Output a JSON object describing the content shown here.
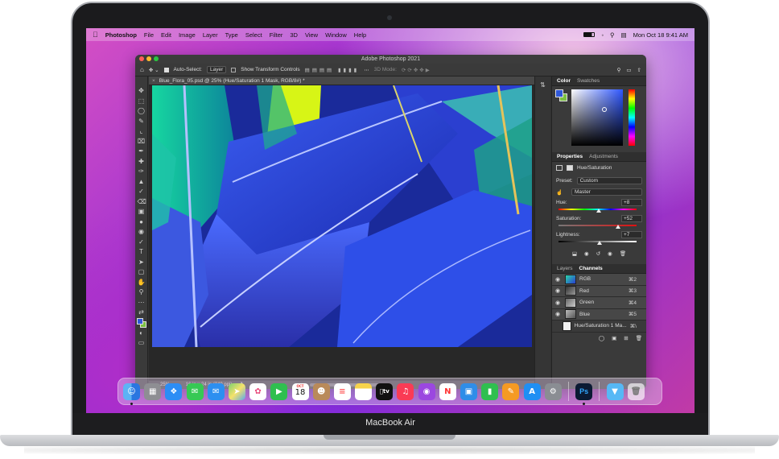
{
  "device": {
    "label": "MacBook Air"
  },
  "menubar": {
    "app_name": "Photoshop",
    "items": [
      "File",
      "Edit",
      "Image",
      "Layer",
      "Type",
      "Select",
      "Filter",
      "3D",
      "View",
      "Window",
      "Help"
    ],
    "clock": "Mon Oct 18  9:41 AM"
  },
  "photoshop": {
    "window_title": "Adobe Photoshop 2021",
    "options": {
      "auto_select_label": "Auto-Select:",
      "auto_select_value": "Layer",
      "transform_label": "Show Transform Controls",
      "mode_label": "3D Mode:"
    },
    "document_tab": "Blue_Flora_05.psd @ 25% (Hue/Saturation 1 Mask, RGB/8#) *",
    "status": {
      "zoom": "25%",
      "doc_size": "16 in x 24 in (240 ppi)"
    },
    "color_panel": {
      "tabs": [
        "Color",
        "Swatches"
      ]
    },
    "properties_panel": {
      "tabs": [
        "Properties",
        "Adjustments"
      ],
      "adjustment_name": "Hue/Saturation",
      "preset_label": "Preset:",
      "preset_value": "Custom",
      "range_value": "Master",
      "hue_label": "Hue:",
      "hue_value": "+8",
      "hue_fraction": 0.52,
      "saturation_label": "Saturation:",
      "saturation_value": "+52",
      "saturation_fraction": 0.76,
      "lightness_label": "Lightness:",
      "lightness_value": "+7",
      "lightness_fraction": 0.53
    },
    "channels_panel": {
      "tabs": [
        "Layers",
        "Channels"
      ],
      "channels": [
        {
          "name": "RGB",
          "shortcut": "⌘2"
        },
        {
          "name": "Red",
          "shortcut": "⌘3"
        },
        {
          "name": "Green",
          "shortcut": "⌘4"
        },
        {
          "name": "Blue",
          "shortcut": "⌘5"
        },
        {
          "name": "Hue/Saturation 1 Ma...",
          "shortcut": "⌘\\"
        }
      ]
    }
  },
  "dock": {
    "calendar_day": "18",
    "calendar_month": "OCT",
    "photoshop_label": "Ps",
    "tv_label": "tv"
  }
}
